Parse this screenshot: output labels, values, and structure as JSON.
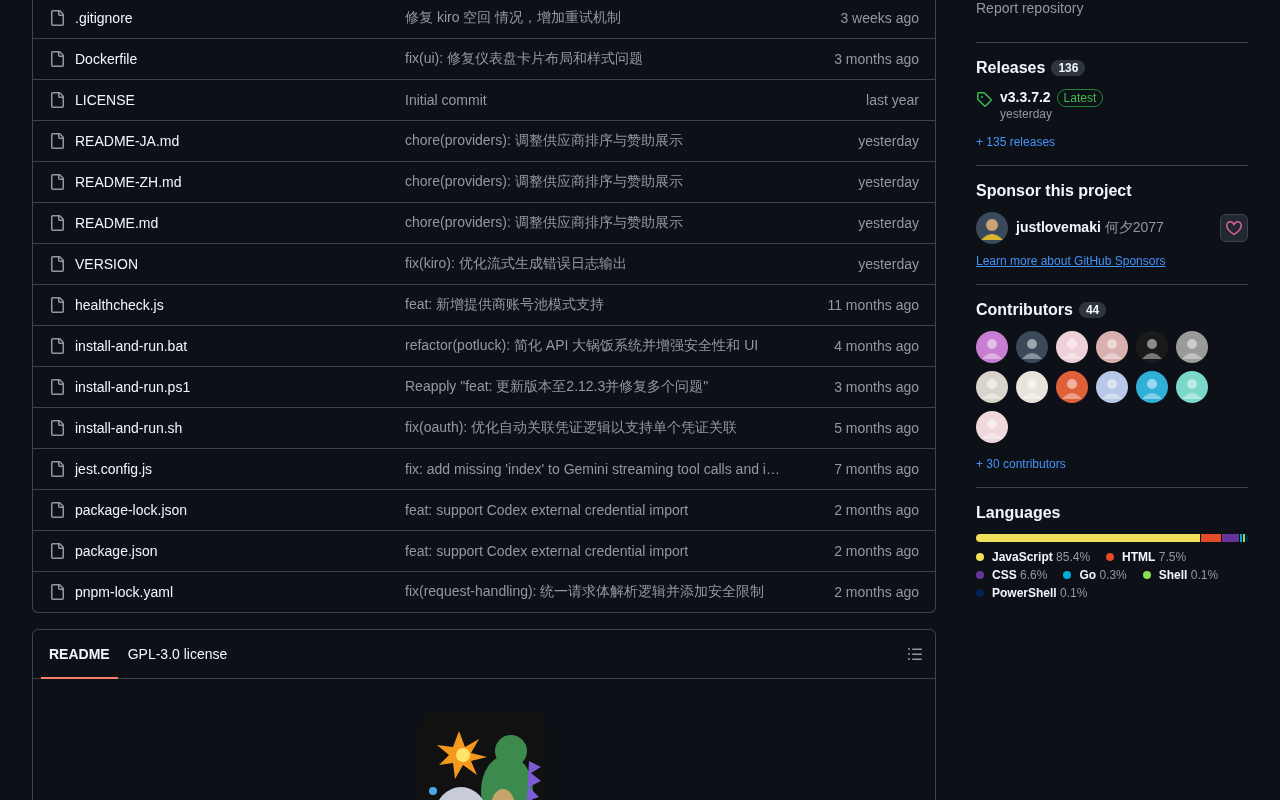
{
  "files": [
    {
      "name": ".gitignore",
      "message": "修复 kiro 空回 情况，增加重试机制",
      "age": "3 weeks ago"
    },
    {
      "name": "Dockerfile",
      "message": "fix(ui): 修复仪表盘卡片布局和样式问题",
      "age": "3 months ago"
    },
    {
      "name": "LICENSE",
      "message": "Initial commit",
      "age": "last year"
    },
    {
      "name": "README-JA.md",
      "message": "chore(providers): 调整供应商排序与赞助展示",
      "age": "yesterday"
    },
    {
      "name": "README-ZH.md",
      "message": "chore(providers): 调整供应商排序与赞助展示",
      "age": "yesterday"
    },
    {
      "name": "README.md",
      "message": "chore(providers): 调整供应商排序与赞助展示",
      "age": "yesterday"
    },
    {
      "name": "VERSION",
      "message": "fix(kiro): 优化流式生成错误日志输出",
      "age": "yesterday"
    },
    {
      "name": "healthcheck.js",
      "message": "feat: 新增提供商账号池模式支持",
      "age": "11 months ago"
    },
    {
      "name": "install-and-run.bat",
      "message": "refactor(potluck): 简化 API 大锅饭系统并增强安全性和 UI",
      "age": "4 months ago"
    },
    {
      "name": "install-and-run.ps1",
      "message": "Reapply \"feat: 更新版本至2.12.3并修复多个问题\"",
      "age": "3 months ago"
    },
    {
      "name": "install-and-run.sh",
      "message": "fix(oauth): 优化自动关联凭证逻辑以支持单个凭证关联",
      "age": "5 months ago"
    },
    {
      "name": "jest.config.js",
      "message": "fix: add missing 'index' to Gemini streaming tool calls and i…",
      "age": "7 months ago"
    },
    {
      "name": "package-lock.json",
      "message": "feat: support Codex external credential import",
      "age": "2 months ago"
    },
    {
      "name": "package.json",
      "message": "feat: support Codex external credential import",
      "age": "2 months ago"
    },
    {
      "name": "pnpm-lock.yaml",
      "message": "fix(request-handling): 统一请求体解析逻辑并添加安全限制",
      "age": "2 months ago"
    }
  ],
  "readme": {
    "tabs": [
      {
        "label": "README",
        "selected": true
      },
      {
        "label": "GPL-3.0 license",
        "selected": false
      }
    ]
  },
  "sidebar": {
    "report_link": "Report repository",
    "releases": {
      "title": "Releases",
      "count": "136",
      "latest": {
        "version": "v3.3.7.2",
        "badge": "Latest",
        "date": "yesterday"
      },
      "more": "+ 135 releases"
    },
    "sponsor": {
      "title": "Sponsor this project",
      "user": "justlovemaki",
      "display_name": "何夕2077",
      "learn_more": "Learn more about GitHub Sponsors"
    },
    "contributors": {
      "title": "Contributors",
      "count": "44",
      "avatars": [
        {
          "color": "#c77dd0"
        },
        {
          "color": "#3a4a5a"
        },
        {
          "color": "#f0d0d8"
        },
        {
          "color": "#d8b0b0"
        },
        {
          "color": "#1a1a1a"
        },
        {
          "color": "#9a9a9a"
        },
        {
          "color": "#d8d4cc"
        },
        {
          "color": "#e8e4dc"
        },
        {
          "color": "#e0603a"
        },
        {
          "color": "#b8c8e8"
        },
        {
          "color": "#30b0d8"
        },
        {
          "color": "#7ad8c8"
        },
        {
          "color": "#f0d8dc"
        }
      ],
      "more": "+ 30 contributors"
    },
    "languages": {
      "title": "Languages",
      "items": [
        {
          "name": "JavaScript",
          "percent": "85.4%",
          "color": "#f1e05a"
        },
        {
          "name": "HTML",
          "percent": "7.5%",
          "color": "#e34c26"
        },
        {
          "name": "CSS",
          "percent": "6.6%",
          "color": "#663399"
        },
        {
          "name": "Go",
          "percent": "0.3%",
          "color": "#00add8"
        },
        {
          "name": "Shell",
          "percent": "0.1%",
          "color": "#89e051"
        },
        {
          "name": "PowerShell",
          "percent": "0.1%",
          "color": "#012456"
        }
      ]
    }
  }
}
